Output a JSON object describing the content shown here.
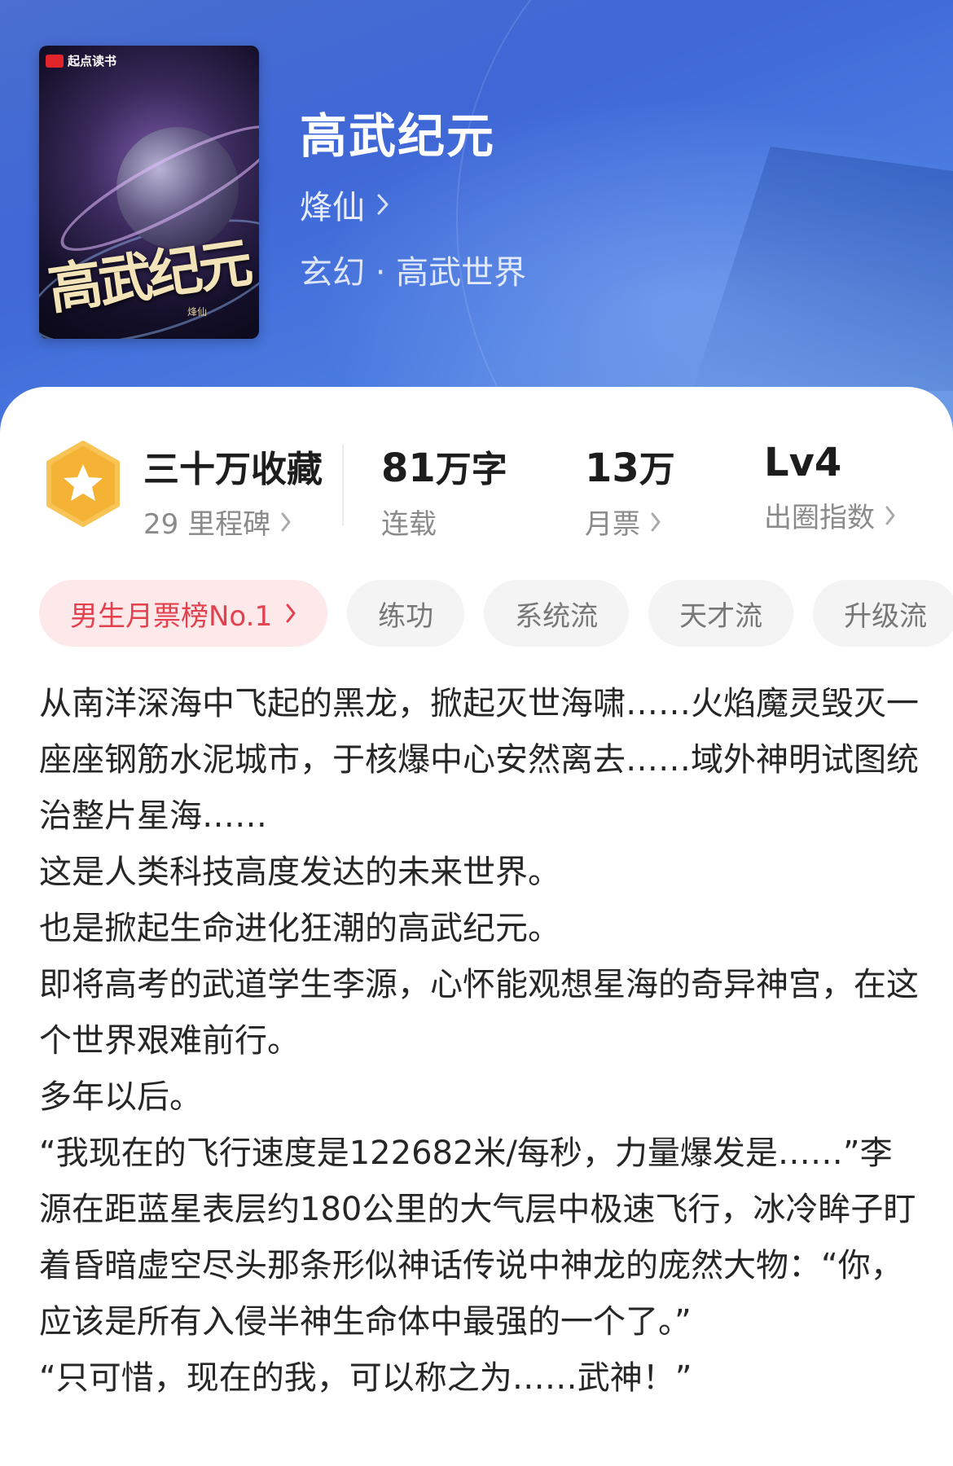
{
  "cover": {
    "brand": "起点读书",
    "title_art": "高武纪元",
    "author_art": "烽仙"
  },
  "book": {
    "title": "高武纪元",
    "author": "烽仙",
    "genre": "玄幻 · 高武世界"
  },
  "stats": {
    "favorites": "三十万收藏",
    "milestones": "29 里程碑",
    "words_num": "81",
    "words_unit": "万字",
    "status": "连载",
    "tickets_num": "13",
    "tickets_unit": "万",
    "tickets_label": "月票",
    "level": "Lv4",
    "level_label": "出圈指数"
  },
  "tags": [
    {
      "label": "男生月票榜No.1"
    },
    {
      "label": "练功"
    },
    {
      "label": "系统流"
    },
    {
      "label": "天才流"
    },
    {
      "label": "升级流"
    }
  ],
  "description": [
    "从南洋深海中飞起的黑龙，掀起灭世海啸……火焰魔灵毁灭一座座钢筋水泥城市，于核爆中心安然离去……域外神明试图统治整片星海……",
    "这是人类科技高度发达的未来世界。",
    "也是掀起生命进化狂潮的高武纪元。",
    "即将高考的武道学生李源，心怀能观想星海的奇异神宫，在这个世界艰难前行。",
    "多年以后。",
    "“我现在的飞行速度是122682米/每秒，力量爆发是……”李源在距蓝星表层约180公里的大气层中极速飞行，冰冷眸子盯着昏暗虚空尽头那条形似神话传说中神龙的庞然大物：“你，应该是所有入侵半神生命体中最强的一个了。”",
    "“只可惜，现在的我，可以称之为……武神！”"
  ],
  "colors": {
    "hero": "#3f67d6",
    "badge": "#f5b335",
    "hot_tag_bg": "#fde8ea",
    "hot_tag_text": "#e4414f"
  }
}
